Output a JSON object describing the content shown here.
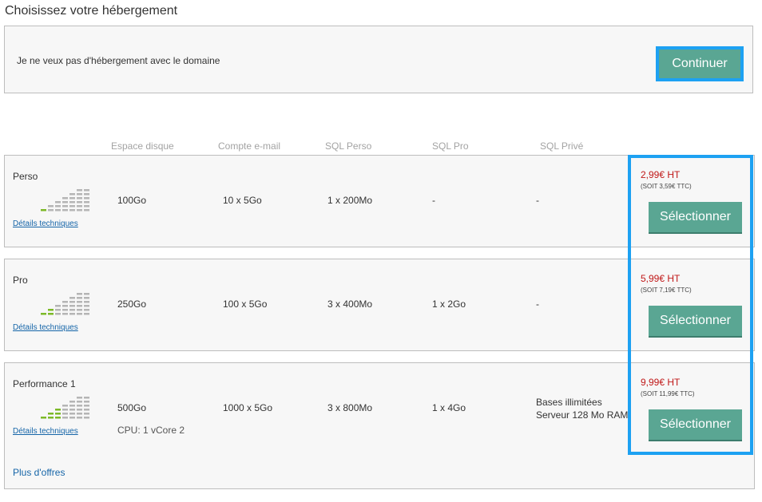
{
  "page_title": "Choisissez votre hébergement",
  "no_hosting": {
    "label": "Je ne veux pas d'hébergement avec le domaine",
    "button": "Continuer"
  },
  "columns": [
    "Espace disque",
    "Compte e-mail",
    "SQL Perso",
    "SQL Pro",
    "SQL Privé"
  ],
  "plans": [
    {
      "name": "Perso",
      "level_bars": 1,
      "details_link": "Détails techniques",
      "disk": "100Go",
      "email": "10 x 5Go",
      "sql_perso": "1 x 200Mo",
      "sql_pro": "-",
      "sql_prive": "-",
      "price": "2,99€ HT",
      "price_ttc": "(SOIT 3,59€ TTC)",
      "select_label": "Sélectionner"
    },
    {
      "name": "Pro",
      "level_bars": 2,
      "details_link": "Détails techniques",
      "disk": "250Go",
      "email": "100 x 5Go",
      "sql_perso": "3 x 400Mo",
      "sql_pro": "1 x 2Go",
      "sql_prive": "-",
      "price": "5,99€ HT",
      "price_ttc": "(SOIT 7,19€ TTC)",
      "select_label": "Sélectionner"
    },
    {
      "name": "Performance 1",
      "level_bars": 3,
      "details_link": "Détails techniques",
      "disk": "500Go",
      "cpu": "CPU: 1 vCore  2",
      "email": "1000 x 5Go",
      "sql_perso": "3 x 800Mo",
      "sql_pro": "1 x 4Go",
      "sql_prive_line1": "Bases illimitées",
      "sql_prive_line2": "Serveur 128 Mo RAM",
      "price": "9,99€ HT",
      "price_ttc": "(SOIT 11,99€ TTC)",
      "select_label": "Sélectionner"
    }
  ],
  "more_offers": "Plus d'offres",
  "colors": {
    "accent_green": "#5aa693",
    "highlight_blue": "#1da1f2",
    "price_red": "#c01818",
    "bar_active": "#7cb927",
    "bar_inactive": "#b5b5b5"
  },
  "icons": {
    "level_bars": "performance-level-bars-icon"
  }
}
